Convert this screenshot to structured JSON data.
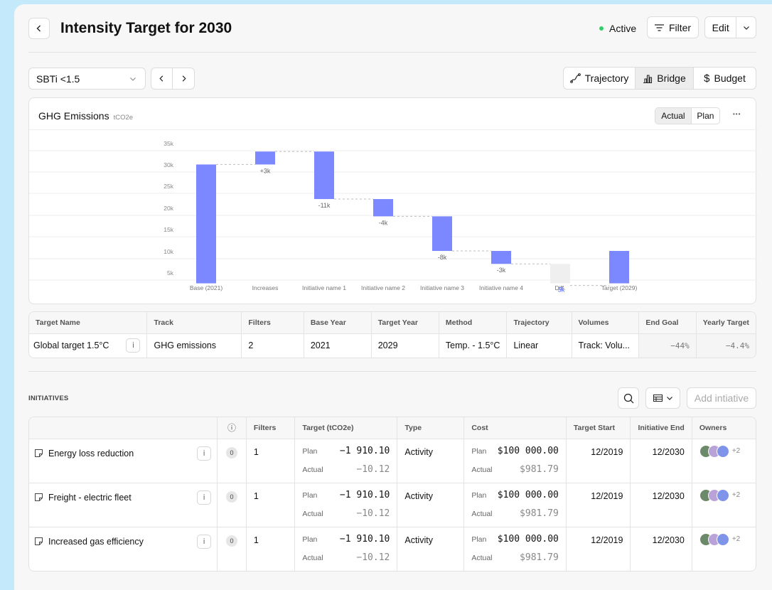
{
  "header": {
    "title": "Intensity Target for 2030",
    "status": "Active",
    "filter_label": "Filter",
    "edit_label": "Edit"
  },
  "toolbar": {
    "scenario": "SBTi <1.5",
    "views": [
      "Trajectory",
      "Bridge",
      "Budget"
    ],
    "active_view": "Bridge"
  },
  "chart_card": {
    "title": "GHG Emissions",
    "unit": "tCO2e",
    "toggle": [
      "Actual",
      "Plan"
    ],
    "active_toggle": "Actual",
    "more": "•••"
  },
  "chart_data": {
    "type": "bar",
    "subtype": "waterfall",
    "categories": [
      "Base (2021)",
      "Increases",
      "Initiative name 1",
      "Initiative name 2",
      "Initiative name 3",
      "Initiative name 4",
      "Diff.",
      "Target (2029)"
    ],
    "values": [
      30000,
      3000,
      -11000,
      -4000,
      -8000,
      -3000,
      -5000,
      10000
    ],
    "data_labels": [
      "",
      "+3k",
      "-11k",
      "-4k",
      "-8k",
      "-3k",
      "-5k",
      ""
    ],
    "y_ticks": [
      "35k",
      "30k",
      "25k",
      "20k",
      "15k",
      "10k",
      "5k"
    ],
    "ylim": [
      2500,
      35000
    ],
    "colors": {
      "bar": "#7b88ff",
      "diff": "#efefef",
      "diff_label": "#4a5cff",
      "connector": "#bdbdbd"
    }
  },
  "target_table": {
    "columns": [
      "Target Name",
      "Track",
      "Filters",
      "Base Year",
      "Target Year",
      "Method",
      "Trajectory",
      "Volumes",
      "End Goal",
      "Yearly Target"
    ],
    "row": [
      "Global target 1.5°C",
      "GHG emissions",
      "2",
      "2021",
      "2029",
      "Temp. - 1.5°C",
      "Linear",
      "Track: Volu...",
      "−44%",
      "−4.4%"
    ],
    "info": "i"
  },
  "initiatives": {
    "section_label": "INITIATIVES",
    "add_label": "Add intiative",
    "columns": [
      "",
      "ⓘ",
      "Filters",
      "Target (tCO2e)",
      "Type",
      "Cost",
      "Target Start",
      "Initiative End",
      "Owners"
    ],
    "plan_label": "Plan",
    "actual_label": "Actual",
    "rows": [
      {
        "name": "Energy loss reduction",
        "info": "i",
        "badge": "0",
        "filters": "1",
        "target_plan": "−1 910.10",
        "target_actual": "−10.12",
        "type": "Activity",
        "cost_plan": "$100 000.00",
        "cost_actual": "$981.79",
        "start": "12/2019",
        "end": "12/2030",
        "more_owners": "+2"
      },
      {
        "name": "Freight - electric fleet",
        "info": "i",
        "badge": "0",
        "filters": "1",
        "target_plan": "−1 910.10",
        "target_actual": "−10.12",
        "type": "Activity",
        "cost_plan": "$100 000.00",
        "cost_actual": "$981.79",
        "start": "12/2019",
        "end": "12/2030",
        "more_owners": "+2"
      },
      {
        "name": "Increased gas efficiency",
        "info": "i",
        "badge": "0",
        "filters": "1",
        "target_plan": "−1 910.10",
        "target_actual": "−10.12",
        "type": "Activity",
        "cost_plan": "$100 000.00",
        "cost_actual": "$981.79",
        "start": "12/2019",
        "end": "12/2030",
        "more_owners": "+2"
      }
    ]
  }
}
